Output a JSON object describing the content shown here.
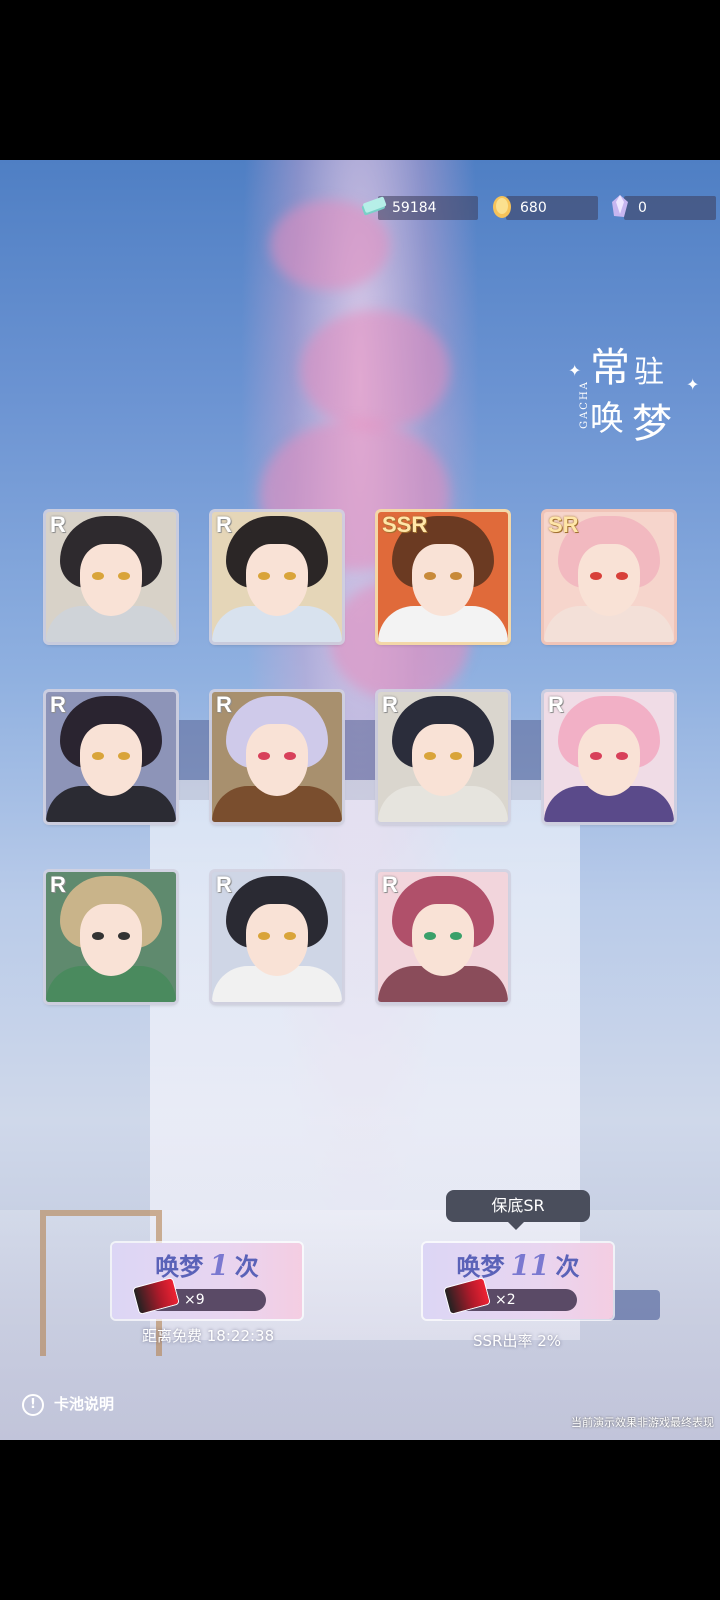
{
  "currencies": [
    {
      "name": "diamond-ticket",
      "value": "59184",
      "color": "#8fe0d8"
    },
    {
      "name": "gold-coin",
      "value": "680",
      "color": "#f6c35a"
    },
    {
      "name": "crystal",
      "value": "0",
      "color": "#c7b6f0"
    }
  ],
  "banner": {
    "line1a": "常",
    "line1b": "驻",
    "line2a": "唤",
    "line2b": "梦",
    "vertical": "GACHA"
  },
  "cards": [
    {
      "rarity": "R",
      "hair": "#2e2a2e",
      "bg": "#d8d2c8",
      "outfit": "#cfd3d8",
      "eye": "#d9a43a"
    },
    {
      "rarity": "R",
      "hair": "#2b2626",
      "bg": "#e5d6b8",
      "outfit": "#d8e2ee",
      "eye": "#d9a43a"
    },
    {
      "rarity": "SSR",
      "hair": "#6b3a22",
      "bg": "#e06a3a",
      "outfit": "#f3f3f3",
      "eye": "#c88a3a"
    },
    {
      "rarity": "SR",
      "hair": "#f2b9c0",
      "bg": "#f6d5cc",
      "outfit": "#f3e0d8",
      "eye": "#d8403a"
    },
    {
      "rarity": "R",
      "hair": "#2a2430",
      "bg": "#8d94b8",
      "outfit": "#2b2b33",
      "eye": "#d9a43a"
    },
    {
      "rarity": "R",
      "hair": "#cfcaea",
      "bg": "#a8906e",
      "outfit": "#7a4e2e",
      "eye": "#d8405a"
    },
    {
      "rarity": "R",
      "hair": "#2b2d3b",
      "bg": "#dad6ce",
      "outfit": "#e6e4de",
      "eye": "#d9a43a"
    },
    {
      "rarity": "R",
      "hair": "#f2b0c6",
      "bg": "#f0dce6",
      "outfit": "#5a4a8a",
      "eye": "#d8405a"
    },
    {
      "rarity": "R",
      "hair": "#c9b48a",
      "bg": "#5f8a6e",
      "outfit": "#4a8a5e",
      "eye": "#333333"
    },
    {
      "rarity": "R",
      "hair": "#2a2a33",
      "bg": "#cfd6e6",
      "outfit": "#f1f1f1",
      "eye": "#d9a43a"
    },
    {
      "rarity": "R",
      "hair": "#b0506a",
      "bg": "#f2d5dc",
      "outfit": "#8a4c5a",
      "eye": "#3aa06a"
    }
  ],
  "pull_one": {
    "prefix": "唤梦",
    "number": "1",
    "suffix": "次",
    "count": "×9"
  },
  "pull_eleven": {
    "prefix": "唤梦",
    "number": "11",
    "suffix": "次",
    "count": "×2"
  },
  "free_timer": "距离免费 18:22:38",
  "ssr_rate": "SSR出率 2%",
  "tooltip": "保底SR",
  "info_label": "卡池说明",
  "info_icon": "!",
  "disclaimer": "当前演示效果非游戏最终表现"
}
